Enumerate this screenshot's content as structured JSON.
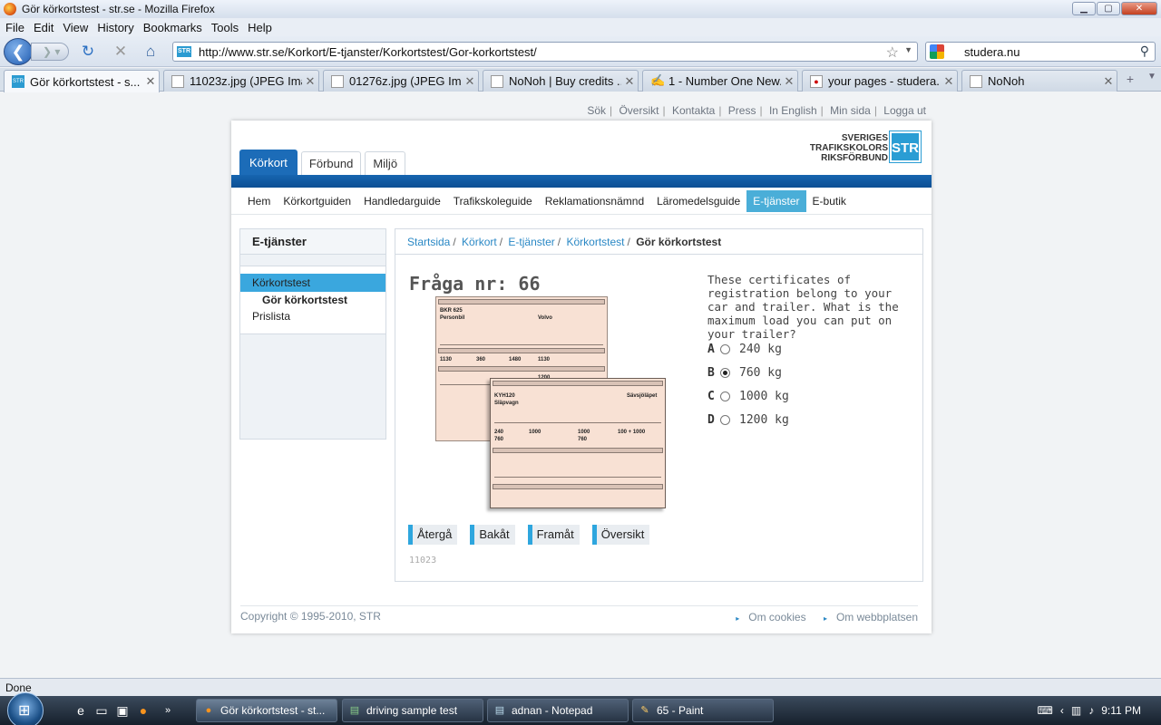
{
  "window": {
    "title": "Gör körkortstest - str.se - Mozilla Firefox",
    "btn_min": "▁",
    "btn_max": "▢",
    "btn_close": "✕"
  },
  "menu": [
    "File",
    "Edit",
    "View",
    "History",
    "Bookmarks",
    "Tools",
    "Help"
  ],
  "nav": {
    "url": "http://www.str.se/Korkort/E-tjanster/Korkortstest/Gor-korkortstest/",
    "search_value": "studera.nu",
    "site_icon_text": "STR"
  },
  "tabs": [
    {
      "label": "Gör körkortstest - s...",
      "icon": "STR"
    },
    {
      "label": "11023z.jpg (JPEG Ima...",
      "icon": ""
    },
    {
      "label": "01276z.jpg (JPEG Ima...",
      "icon": ""
    },
    {
      "label": "NoNoh | Buy credits ...",
      "icon": ""
    },
    {
      "label": "1 - Number One New...",
      "icon": ""
    },
    {
      "label": "your pages - studera....",
      "icon": "●"
    },
    {
      "label": "NoNoh",
      "icon": ""
    }
  ],
  "toplinks": [
    "Sök",
    "Översikt",
    "Kontakta",
    "Press",
    "In English",
    "Min sida",
    "Logga ut"
  ],
  "logo": {
    "line1": "SVERIGES",
    "line2": "TRAFIKSKOLORS",
    "line3": "RIKSFÖRBUND",
    "abbr": "STR"
  },
  "maintabs": [
    "Körkort",
    "Förbund",
    "Miljö"
  ],
  "subnav": [
    "Hem",
    "Körkortguiden",
    "Handledarguide",
    "Trafikskoleguide",
    "Reklamationsnämnd",
    "Läromedelsguide",
    "E-tjänster",
    "E-butik"
  ],
  "sidebar": {
    "heading": "E-tjänster",
    "items": [
      "Körkortstest",
      "Gör körkortstest",
      "Prislista"
    ]
  },
  "breadcrumb": {
    "items": [
      "Startsida",
      "Körkort",
      "E-tjänster",
      "Körkortstest"
    ],
    "current": "Gör körkortstest"
  },
  "question": {
    "heading": "Fråga nr: 66",
    "text": "These certificates of registration belong to your car and trailer. What is the maximum load you can put on your trailer?",
    "answers": [
      {
        "letter": "A",
        "text": "240 kg",
        "selected": false
      },
      {
        "letter": "B",
        "text": "760 kg",
        "selected": true
      },
      {
        "letter": "C",
        "text": "1000 kg",
        "selected": false
      },
      {
        "letter": "D",
        "text": "1200 kg",
        "selected": false
      }
    ],
    "id": "11023"
  },
  "buttons": [
    "Återgå",
    "Bakåt",
    "Framåt",
    "Översikt"
  ],
  "regdoc": {
    "car_reg": "BKR 625",
    "car_make": "Volvo",
    "car_kind": "Personbil",
    "car_val1": "1130",
    "car_val2": "360",
    "car_val3": "1480",
    "car_val4": "1130",
    "car_hitch": "1200",
    "trailer_reg": "KYH120",
    "trailer_make": "Sävsjöläpet",
    "trailer_kind": "Släpvagn",
    "trailer_val1": "240",
    "trailer_val2": "1000",
    "trailer_val3": "1000",
    "trailer_val4": "100 + 1000",
    "trailer_val5": "760",
    "trailer_val6": "760"
  },
  "footer": {
    "copyright": "Copyright © 1995-2010, STR",
    "links": [
      "Om cookies",
      "Om webbplatsen"
    ]
  },
  "status": "Done",
  "taskbar": {
    "items": [
      "Gör körkortstest - st...",
      "driving sample test",
      "adnan - Notepad",
      "65 - Paint"
    ],
    "clock": "9:11 PM"
  }
}
